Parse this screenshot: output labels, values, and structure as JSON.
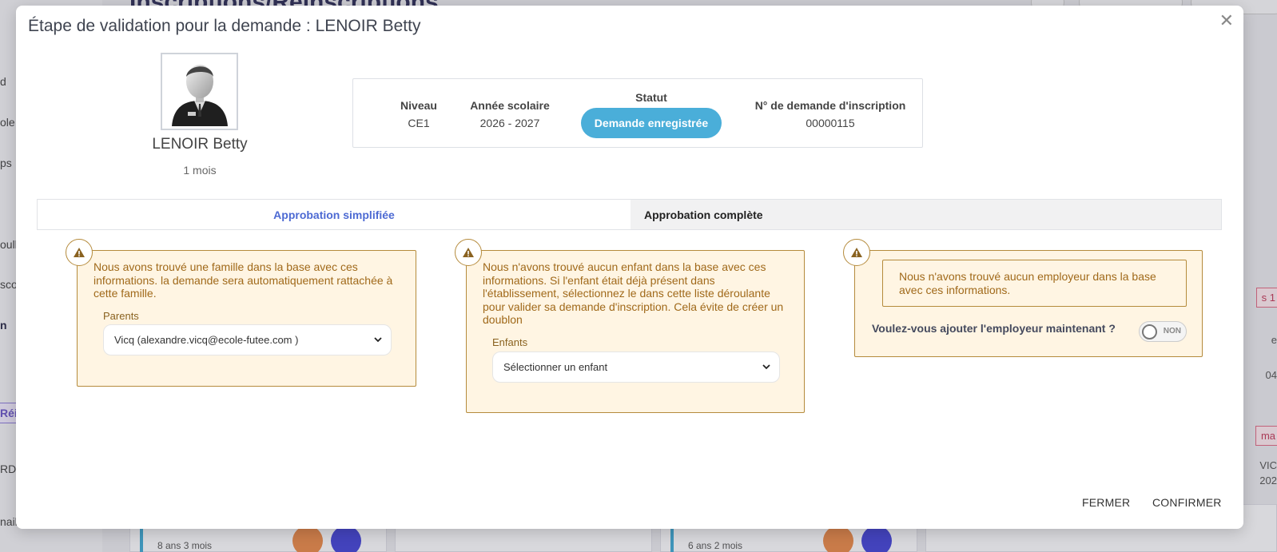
{
  "background": {
    "title": "Inscriptions/Réinscriptions",
    "sidebar": [
      "d",
      "ole",
      "ps",
      "oull",
      "sco",
      "n",
      "Réi",
      "RDV",
      "nail"
    ],
    "cards": [
      {
        "age": "8 ans 3 mois"
      },
      {
        "age": "6 ans 2 mois"
      }
    ],
    "right_texts": [
      "e",
      "04",
      "VIC",
      "202"
    ],
    "right_pills": [
      "s 1",
      "ma"
    ]
  },
  "modal": {
    "title": "Étape de validation pour la demande : LENOIR Betty",
    "close_glyph": "✕",
    "child": {
      "name": "LENOIR Betty",
      "age": "1 mois"
    },
    "info": {
      "niveau_label": "Niveau",
      "niveau_value": "CE1",
      "annee_label": "Année scolaire",
      "annee_value": "2026 - 2027",
      "statut_label": "Statut",
      "statut_value": "Demande enregistrée",
      "demande_label": "N° de demande d'inscription",
      "demande_value": "00000115"
    },
    "tabs": [
      {
        "label": "Approbation simplifiée",
        "active": true
      },
      {
        "label": "Approbation complète",
        "active": false
      }
    ],
    "famille": {
      "text": "Nous avons trouvé une famille dans la base avec ces informations. la demande sera automatiquement rattachée à cette famille.",
      "field_label": "Parents",
      "selected": "Vicq (alexandre.vicq@ecole-futee.com )"
    },
    "enfant": {
      "text": "Nous n'avons trouvé aucun enfant dans la base avec ces informations. Si l'enfant était déjà présent dans l'établissement, sélectionnez le dans cette liste déroulante pour valider sa demande d'inscription. Cela évite de créer un doublon",
      "field_label": "Enfants",
      "selected": "Sélectionner un enfant"
    },
    "employeur": {
      "text": "Nous n'avons trouvé aucun employeur dans la base avec ces informations.",
      "question": "Voulez-vous ajouter l'employeur maintenant ?",
      "toggle_label": "NON"
    },
    "buttons": {
      "fermer": "FERMER",
      "confirmer": "CONFIRMER"
    },
    "colors": {
      "accent": "#4d6ad3",
      "status": "#4aaed9",
      "warning_bg": "#fff5e3",
      "warning_border": "#b58b3c",
      "warning_text": "#a0691a"
    }
  }
}
